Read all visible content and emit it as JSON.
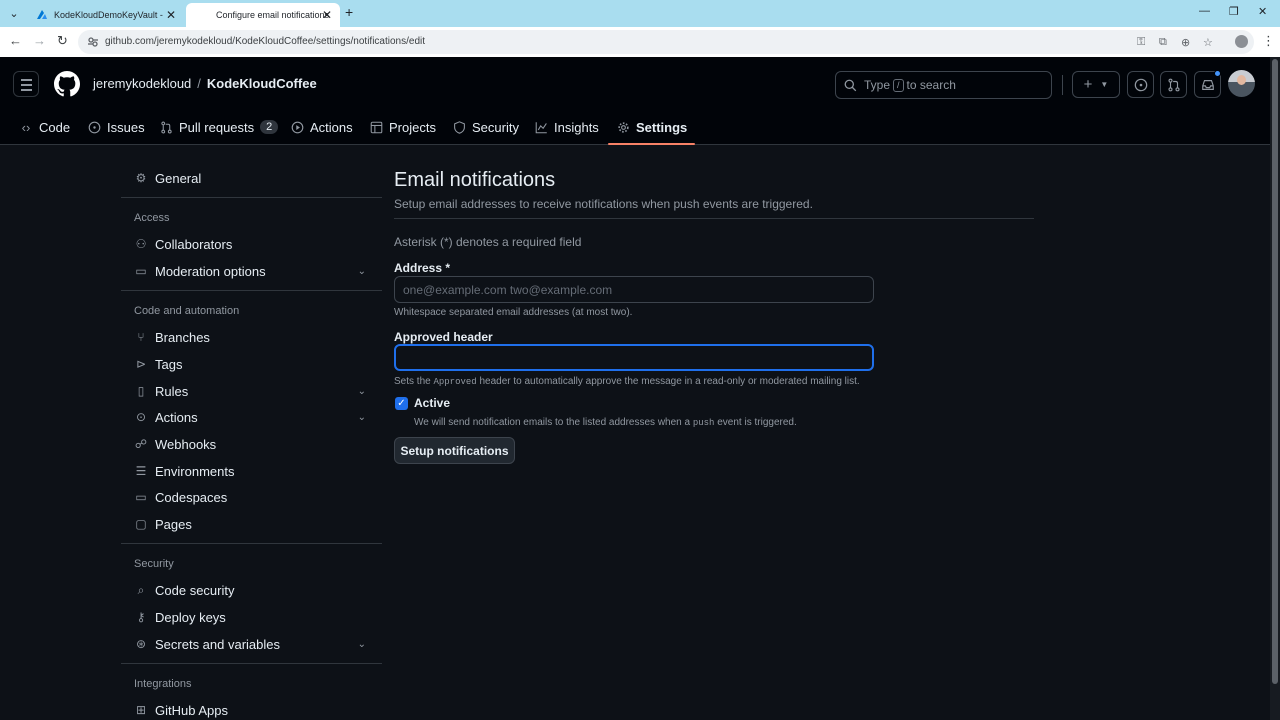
{
  "browser": {
    "tabs": [
      {
        "title": "KodeKloudDemoKeyVault - Mic",
        "active": false
      },
      {
        "title": "Configure email notifications",
        "active": true
      }
    ],
    "url": "github.com/jeremykodekloud/KodeKloudCoffee/settings/notifications/edit"
  },
  "header": {
    "owner": "jeremykodekloud",
    "separator": "/",
    "repo": "KodeKloudCoffee",
    "search_prefix": "Type",
    "search_key": "/",
    "search_suffix": "to search",
    "plus_label": "+"
  },
  "repo_nav": [
    {
      "label": "Code",
      "icon": "code-icon"
    },
    {
      "label": "Issues",
      "icon": "issue-icon"
    },
    {
      "label": "Pull requests",
      "icon": "pull-request-icon",
      "count": "2"
    },
    {
      "label": "Actions",
      "icon": "play-icon"
    },
    {
      "label": "Projects",
      "icon": "table-icon"
    },
    {
      "label": "Security",
      "icon": "shield-icon"
    },
    {
      "label": "Insights",
      "icon": "graph-icon"
    },
    {
      "label": "Settings",
      "icon": "gear-icon",
      "selected": true
    }
  ],
  "sidebar": {
    "general": "General",
    "access_heading": "Access",
    "collaborators": "Collaborators",
    "moderation": "Moderation options",
    "code_heading": "Code and automation",
    "branches": "Branches",
    "tags": "Tags",
    "rules": "Rules",
    "actions": "Actions",
    "webhooks": "Webhooks",
    "environments": "Environments",
    "codespaces": "Codespaces",
    "pages": "Pages",
    "security_heading": "Security",
    "code_security": "Code security",
    "deploy_keys": "Deploy keys",
    "secrets": "Secrets and variables",
    "integrations_heading": "Integrations",
    "github_apps": "GitHub Apps"
  },
  "form": {
    "title": "Email notifications",
    "subtitle": "Setup email addresses to receive notifications when push events are triggered.",
    "required_note": "Asterisk (*) denotes a required field",
    "address_label": "Address *",
    "address_placeholder": "one@example.com two@example.com",
    "address_help": "Whitespace separated email addresses (at most two).",
    "approved_label": "Approved header",
    "approved_value": "",
    "approved_help_pre": "Sets the ",
    "approved_help_code": "Approved",
    "approved_help_post": " header to automatically approve the message in a read-only or moderated mailing list.",
    "active_label": "Active",
    "active_checked": true,
    "active_help_pre": "We will send notification emails to the listed addresses when a ",
    "active_help_code": "push",
    "active_help_post": " event is triggered.",
    "submit_label": "Setup notifications"
  },
  "colors": {
    "accent": "#1f6feb",
    "selected_underline": "#f78166",
    "tabstrip": "#a9ddef",
    "background": "#0d1117"
  }
}
